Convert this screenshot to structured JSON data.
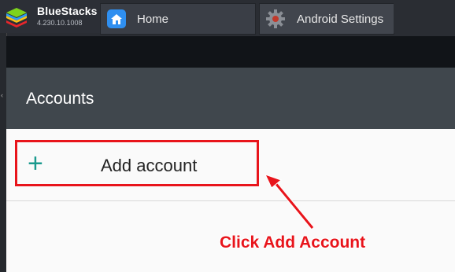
{
  "app": {
    "name": "BlueStacks",
    "version": "4.230.10.1008"
  },
  "tabs": [
    {
      "label": "Home",
      "icon": "home-icon"
    },
    {
      "label": "Android Settings",
      "icon": "gear-icon"
    }
  ],
  "toolbar": {
    "title": "Accounts"
  },
  "accounts": {
    "add_icon": "plus-icon",
    "add_label": "Add account"
  },
  "annotation": {
    "text": "Click Add Account",
    "color": "#e8141b"
  },
  "colors": {
    "accent": "#1a9a8e",
    "toolbar": "#40474d",
    "highlight": "#e8141b"
  }
}
